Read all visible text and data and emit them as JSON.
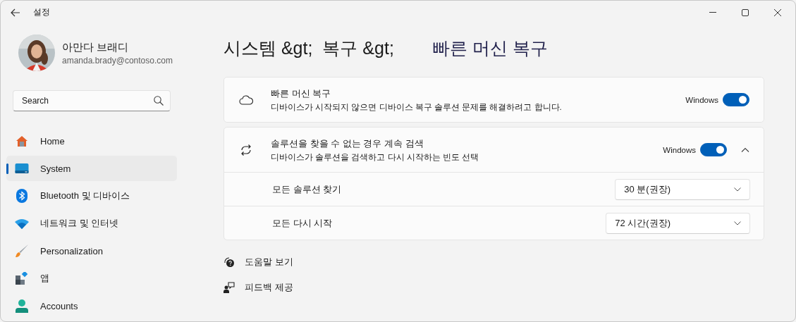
{
  "window": {
    "title": "설정"
  },
  "user": {
    "name": "아만다 브래디",
    "email": "amanda.brady@contoso.com"
  },
  "search": {
    "placeholder": "Search"
  },
  "nav": [
    {
      "label": "Home",
      "selected": false
    },
    {
      "label": "System",
      "selected": true
    },
    {
      "label": "Bluetooth 및 디바이스",
      "selected": false
    },
    {
      "label": "네트워크 및 인터넷",
      "selected": false
    },
    {
      "label": "Personalization",
      "selected": false
    },
    {
      "label": "앱",
      "selected": false
    },
    {
      "label": "Accounts",
      "selected": false
    }
  ],
  "breadcrumb": [
    {
      "text": "시스템 &gt;",
      "current": false
    },
    {
      "text": "복구 &gt;",
      "current": false
    },
    {
      "text": "빠른 머신 복구",
      "current": true
    }
  ],
  "cards": [
    {
      "title": "빠른 머신 복구",
      "description": "디바이스가 시작되지 않으면 디바이스 복구 솔루션 문제를 해결하려고 합니다.",
      "toggle_label": "Windows",
      "on": true
    },
    {
      "title": "솔루션을 찾을 수 없는 경우 계속 검색",
      "description": "디바이스가 솔루션을 검색하고 다시 시작하는 빈도 선택",
      "toggle_label": "Windows",
      "on": true,
      "expanded": true,
      "options": [
        {
          "label": "모든 솔루션 찾기",
          "value": "30 분(권장)"
        },
        {
          "label": "모든 다시 시작",
          "value": "72 시간(권장)"
        }
      ]
    }
  ],
  "links": [
    {
      "label": "도움말 보기"
    },
    {
      "label": "피드백 제공"
    }
  ]
}
